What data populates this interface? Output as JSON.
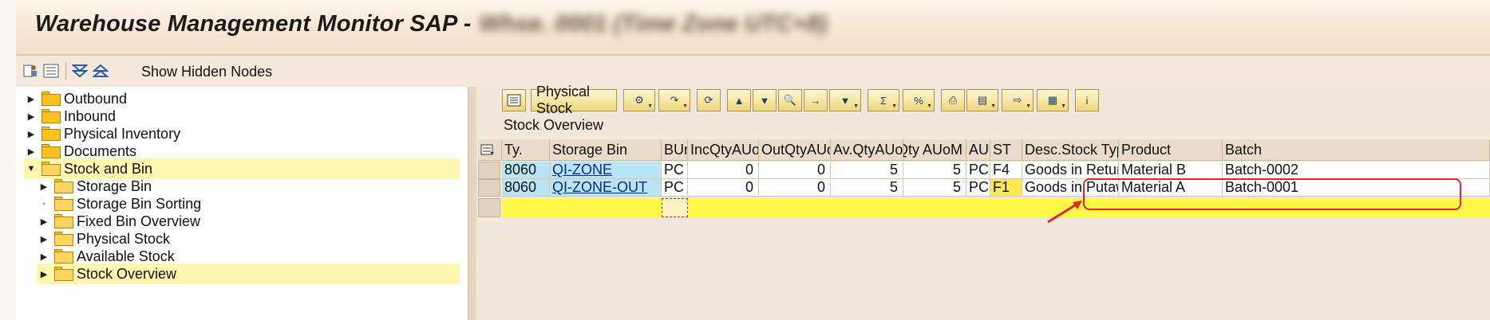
{
  "window": {
    "title": "Warehouse Management Monitor SAP -",
    "title_suffix": "Whse. 0001 (Time Zone UTC+8)"
  },
  "toolbar": {
    "show_hidden_nodes": "Show Hidden Nodes",
    "icons": [
      "personalize-icon",
      "list-icon",
      "expand-all-icon",
      "collapse-all-icon"
    ]
  },
  "tree": {
    "nodes": [
      {
        "label": "Outbound",
        "expanded": false
      },
      {
        "label": "Inbound",
        "expanded": false
      },
      {
        "label": "Physical Inventory",
        "expanded": false
      },
      {
        "label": "Documents",
        "expanded": false
      },
      {
        "label": "Stock and Bin",
        "expanded": true
      },
      {
        "label": "Storage Bin",
        "expanded": false
      },
      {
        "label": "Storage Bin Sorting",
        "expanded": false
      },
      {
        "label": "Fixed Bin Overview",
        "expanded": false
      },
      {
        "label": "Physical Stock",
        "expanded": false
      },
      {
        "label": "Available Stock",
        "expanded": false
      },
      {
        "label": "Stock Overview",
        "expanded": false
      }
    ]
  },
  "right_toolbar": {
    "physical_stock_button": "Physical Stock",
    "icons": [
      "details-icon",
      "settings-icon",
      "transfer-icon",
      "refresh-icon",
      "align-top-icon",
      "align-bottom-icon",
      "find-icon",
      "find-next-icon",
      "filter-icon",
      "sum-icon",
      "subtotal-icon",
      "print-icon",
      "views-icon",
      "export-icon",
      "layout-icon",
      "info-icon"
    ]
  },
  "grid": {
    "title": "Stock Overview",
    "columns": [
      "Ty.",
      "Storage Bin",
      "BUn",
      "IncQtyAUoM",
      "OutQtyAUo…",
      "Av.QtyAUoM",
      "Qty AUoM",
      "AUn",
      "ST",
      "Desc.Stock Type",
      "Product",
      "Batch"
    ],
    "rows": [
      {
        "ty": "8060",
        "bin": "QI-ZONE",
        "bun": "PC",
        "inc": "0",
        "out": "0",
        "av": "5",
        "qty": "5",
        "aun": "PC",
        "st": "F4",
        "desc": "Goods in Return",
        "product": "Material B",
        "batch": "Batch-0002"
      },
      {
        "ty": "8060",
        "bin": "QI-ZONE-OUT",
        "bun": "PC",
        "inc": "0",
        "out": "0",
        "av": "5",
        "qty": "5",
        "aun": "PC",
        "st": "F1",
        "desc": "Goods in Putaw…",
        "product": "Material A",
        "batch": "Batch-0001"
      }
    ]
  },
  "colors": {
    "highlight_border": "#e2242d",
    "selected_row": "#fff84a",
    "key_cell": "#b9e6f4"
  }
}
